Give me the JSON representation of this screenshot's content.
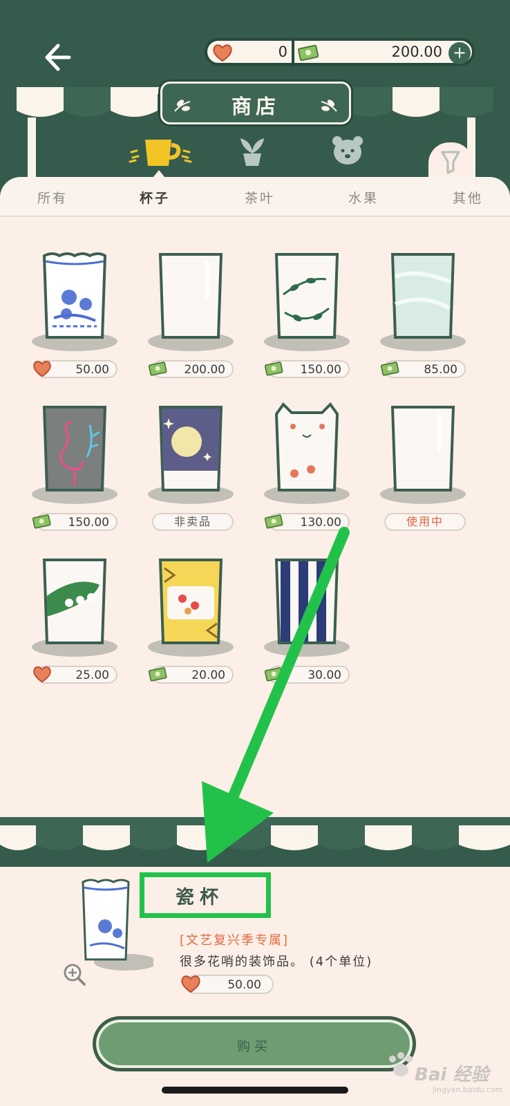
{
  "header": {
    "back_icon": "back-arrow-icon",
    "hearts": "0",
    "money": "200.00",
    "add_icon": "plus-icon",
    "add_label": "+"
  },
  "shop": {
    "title": "商店"
  },
  "categories": [
    {
      "icon": "cup-icon",
      "active": true
    },
    {
      "icon": "plant-icon",
      "active": false
    },
    {
      "icon": "bear-icon",
      "active": false
    },
    {
      "icon": "filter-icon",
      "active": false
    }
  ],
  "tabs": [
    {
      "label": "所有",
      "active": false
    },
    {
      "label": "杯子",
      "active": true
    },
    {
      "label": "茶叶",
      "active": false
    },
    {
      "label": "水果",
      "active": false
    },
    {
      "label": "其他",
      "active": false
    }
  ],
  "items": [
    {
      "kind": "price",
      "currency": "heart",
      "price": "50.00",
      "design": "porcelain"
    },
    {
      "kind": "price",
      "currency": "money",
      "price": "200.00",
      "design": "plain-glass"
    },
    {
      "kind": "price",
      "currency": "money",
      "price": "150.00",
      "design": "leaf-wreath"
    },
    {
      "kind": "price",
      "currency": "money",
      "price": "85.00",
      "design": "mint-marble"
    },
    {
      "kind": "price",
      "currency": "money",
      "price": "150.00",
      "design": "flamingo-neon"
    },
    {
      "kind": "status",
      "status": "非卖品",
      "design": "moon-night"
    },
    {
      "kind": "price",
      "currency": "money",
      "price": "130.00",
      "design": "cat-paw"
    },
    {
      "kind": "status",
      "status": "使用中",
      "design": "plain-glass"
    },
    {
      "kind": "price",
      "currency": "heart",
      "price": "25.00",
      "design": "lily-leaf"
    },
    {
      "kind": "price",
      "currency": "money",
      "price": "20.00",
      "design": "yellow-floral"
    },
    {
      "kind": "price",
      "currency": "money",
      "price": "30.00",
      "design": "navy-stripe"
    }
  ],
  "detail": {
    "name": "瓷杯",
    "tag": "[文艺复兴季专属]",
    "description": "很多花哨的装饰品。 (4个单位)",
    "currency": "heart",
    "price": "50.00",
    "zoom_icon": "zoom-in-icon"
  },
  "buy_label": "购买",
  "watermark": {
    "text": "Bai 经验",
    "sub": "jingyan.baidu.com"
  },
  "colors": {
    "dark_green": "#355b4c",
    "panel": "#fcefe7",
    "awning_green": "#3d6654",
    "highlight": "#22c24a",
    "tag_orange": "#e46a40",
    "buy_fill": "#6f9d73"
  }
}
